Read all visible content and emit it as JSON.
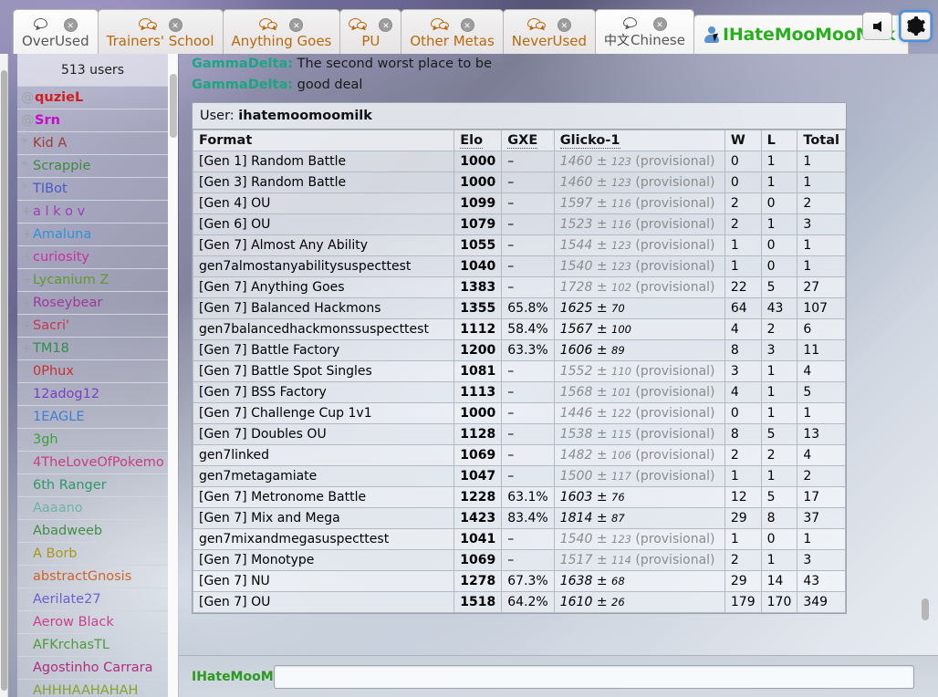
{
  "window": {
    "tabs": [
      {
        "label": "OverUsed",
        "icon": "chat-bubble-icon",
        "active": true,
        "close": "close-icon"
      },
      {
        "label": "Trainers' School",
        "icon": "chat-bubbles-icon",
        "active": false,
        "close": "close-icon"
      },
      {
        "label": "Anything Goes",
        "icon": "chat-bubbles-icon",
        "active": false,
        "close": "close-icon"
      },
      {
        "label": "PU",
        "icon": "chat-bubbles-icon",
        "active": false,
        "close": "close-icon"
      },
      {
        "label": "Other Metas",
        "icon": "chat-bubbles-icon",
        "active": false,
        "close": "close-icon"
      },
      {
        "label": "NeverUsed",
        "icon": "chat-bubbles-icon",
        "active": false,
        "close": "close-icon"
      },
      {
        "label": "Chinese",
        "prefix": "中文",
        "icon": "chat-bubble-icon",
        "active": true,
        "close": "close-icon"
      }
    ],
    "user_tab": {
      "name": "IHateMooMooMilk",
      "icon": "user-icon",
      "color": "#28b01c"
    },
    "buttons": [
      {
        "name": "volume-button",
        "icon": "speaker-icon"
      },
      {
        "name": "settings-button",
        "icon": "gear-icon"
      }
    ]
  },
  "userlist": {
    "count_label": "513 users",
    "users": [
      {
        "rank": "@",
        "name": "quzieL",
        "color": "#d31e1e",
        "staff": true
      },
      {
        "rank": "@",
        "name": "Srn",
        "color": "#c90bc9",
        "staff": true
      },
      {
        "rank": "*",
        "name": "Kid A",
        "color": "#9e3b33"
      },
      {
        "rank": "*",
        "name": "Scrappie",
        "color": "#3f8a3f"
      },
      {
        "rank": "*",
        "name": "TIBot",
        "color": "#4a58c4"
      },
      {
        "rank": "+",
        "name": "a l k o v",
        "color": "#9c3fb5"
      },
      {
        "rank": "+",
        "name": "Amaluna",
        "color": "#2e93d4"
      },
      {
        "rank": "+",
        "name": "curiosity",
        "color": "#cc2f9e"
      },
      {
        "rank": "+",
        "name": "Lycanium Z",
        "color": "#5d9c2c"
      },
      {
        "rank": "+",
        "name": "Roseybear",
        "color": "#a0379b"
      },
      {
        "rank": "+",
        "name": "Sacri'",
        "color": "#c43a4e"
      },
      {
        "rank": "+",
        "name": "TM18",
        "color": "#2f8f4b"
      },
      {
        "rank": "",
        "name": "0Phux",
        "color": "#c2302f"
      },
      {
        "rank": "",
        "name": "12adog12",
        "color": "#7a3fc4"
      },
      {
        "rank": "",
        "name": "1EAGLE",
        "color": "#3d7fd4"
      },
      {
        "rank": "",
        "name": "3gh",
        "color": "#3aa03a"
      },
      {
        "rank": "",
        "name": "4TheLoveOfPokemo",
        "color": "#c73c86"
      },
      {
        "rank": "",
        "name": "6th Ranger",
        "color": "#2f9669"
      },
      {
        "rank": "",
        "name": "Aaaano",
        "color": "#69b5a4"
      },
      {
        "rank": "",
        "name": "Abadweeb",
        "color": "#3f8f45"
      },
      {
        "rank": "",
        "name": "A Borb",
        "color": "#a59a17"
      },
      {
        "rank": "",
        "name": "abstractGnosis",
        "color": "#d2622a"
      },
      {
        "rank": "",
        "name": "Aerilate27",
        "color": "#6d5fd0"
      },
      {
        "rank": "",
        "name": "Aerow Black",
        "color": "#cf3e8e"
      },
      {
        "rank": "",
        "name": "AFKrchasTL",
        "color": "#4f9b3a"
      },
      {
        "rank": "",
        "name": "Agostinho Carrara",
        "color": "#b02d7d"
      },
      {
        "rank": "",
        "name": "AHHHAAHAHAH",
        "color": "#86a32c"
      }
    ]
  },
  "chat": {
    "messages": [
      {
        "who": "GammaDelta:",
        "text": "The second worst place to be"
      },
      {
        "who": "GammaDelta:",
        "text": "good deal"
      }
    ],
    "input": {
      "name_label": "IHateMooMc",
      "value": "",
      "placeholder": ""
    }
  },
  "ratings": {
    "user_prefix": "User:",
    "user": "ihatemoomoomilk",
    "columns": [
      "Format",
      "Elo",
      "GXE",
      "Glicko-1",
      "W",
      "L",
      "Total"
    ],
    "provisional_tag": "(provisional)",
    "rows": [
      {
        "format": "[Gen 1] Random Battle",
        "elo": "1000",
        "gxe": "–",
        "glicko": "1460",
        "dev": "123",
        "provisional": true,
        "w": "0",
        "l": "1",
        "total": "1"
      },
      {
        "format": "[Gen 3] Random Battle",
        "elo": "1000",
        "gxe": "–",
        "glicko": "1460",
        "dev": "123",
        "provisional": true,
        "w": "0",
        "l": "1",
        "total": "1"
      },
      {
        "format": "[Gen 4] OU",
        "elo": "1099",
        "gxe": "–",
        "glicko": "1597",
        "dev": "116",
        "provisional": true,
        "w": "2",
        "l": "0",
        "total": "2"
      },
      {
        "format": "[Gen 6] OU",
        "elo": "1079",
        "gxe": "–",
        "glicko": "1523",
        "dev": "116",
        "provisional": true,
        "w": "2",
        "l": "1",
        "total": "3"
      },
      {
        "format": "[Gen 7] Almost Any Ability",
        "elo": "1055",
        "gxe": "–",
        "glicko": "1544",
        "dev": "123",
        "provisional": true,
        "w": "1",
        "l": "0",
        "total": "1"
      },
      {
        "format": "gen7almostanyabilitysuspecttest",
        "elo": "1040",
        "gxe": "–",
        "glicko": "1540",
        "dev": "123",
        "provisional": true,
        "w": "1",
        "l": "0",
        "total": "1"
      },
      {
        "format": "[Gen 7] Anything Goes",
        "elo": "1383",
        "gxe": "–",
        "glicko": "1728",
        "dev": "102",
        "provisional": true,
        "w": "22",
        "l": "5",
        "total": "27"
      },
      {
        "format": "[Gen 7] Balanced Hackmons",
        "elo": "1355",
        "gxe": "65.8%",
        "glicko": "1625",
        "dev": "70",
        "provisional": false,
        "w": "64",
        "l": "43",
        "total": "107"
      },
      {
        "format": "gen7balancedhackmonssuspecttest",
        "elo": "1112",
        "gxe": "58.4%",
        "glicko": "1567",
        "dev": "100",
        "provisional": false,
        "w": "4",
        "l": "2",
        "total": "6"
      },
      {
        "format": "[Gen 7] Battle Factory",
        "elo": "1200",
        "gxe": "63.3%",
        "glicko": "1606",
        "dev": "89",
        "provisional": false,
        "w": "8",
        "l": "3",
        "total": "11"
      },
      {
        "format": "[Gen 7] Battle Spot Singles",
        "elo": "1081",
        "gxe": "–",
        "glicko": "1552",
        "dev": "110",
        "provisional": true,
        "w": "3",
        "l": "1",
        "total": "4"
      },
      {
        "format": "[Gen 7] BSS Factory",
        "elo": "1113",
        "gxe": "–",
        "glicko": "1568",
        "dev": "101",
        "provisional": true,
        "w": "4",
        "l": "1",
        "total": "5"
      },
      {
        "format": "[Gen 7] Challenge Cup 1v1",
        "elo": "1000",
        "gxe": "–",
        "glicko": "1446",
        "dev": "122",
        "provisional": true,
        "w": "0",
        "l": "1",
        "total": "1"
      },
      {
        "format": "[Gen 7] Doubles OU",
        "elo": "1128",
        "gxe": "–",
        "glicko": "1538",
        "dev": "115",
        "provisional": true,
        "w": "8",
        "l": "5",
        "total": "13"
      },
      {
        "format": "gen7linked",
        "elo": "1069",
        "gxe": "–",
        "glicko": "1482",
        "dev": "106",
        "provisional": true,
        "w": "2",
        "l": "2",
        "total": "4"
      },
      {
        "format": "gen7metagamiate",
        "elo": "1047",
        "gxe": "–",
        "glicko": "1500",
        "dev": "117",
        "provisional": true,
        "w": "1",
        "l": "1",
        "total": "2"
      },
      {
        "format": "[Gen 7] Metronome Battle",
        "elo": "1228",
        "gxe": "63.1%",
        "glicko": "1603",
        "dev": "76",
        "provisional": false,
        "w": "12",
        "l": "5",
        "total": "17"
      },
      {
        "format": "[Gen 7] Mix and Mega",
        "elo": "1423",
        "gxe": "83.4%",
        "glicko": "1814",
        "dev": "87",
        "provisional": false,
        "w": "29",
        "l": "8",
        "total": "37"
      },
      {
        "format": "gen7mixandmegasuspecttest",
        "elo": "1041",
        "gxe": "–",
        "glicko": "1540",
        "dev": "123",
        "provisional": true,
        "w": "1",
        "l": "0",
        "total": "1"
      },
      {
        "format": "[Gen 7] Monotype",
        "elo": "1069",
        "gxe": "–",
        "glicko": "1517",
        "dev": "114",
        "provisional": true,
        "w": "2",
        "l": "1",
        "total": "3"
      },
      {
        "format": "[Gen 7] NU",
        "elo": "1278",
        "gxe": "67.3%",
        "glicko": "1638",
        "dev": "68",
        "provisional": false,
        "w": "29",
        "l": "14",
        "total": "43"
      },
      {
        "format": "[Gen 7] OU",
        "elo": "1518",
        "gxe": "64.2%",
        "glicko": "1610",
        "dev": "26",
        "provisional": false,
        "w": "179",
        "l": "170",
        "total": "349"
      }
    ]
  }
}
